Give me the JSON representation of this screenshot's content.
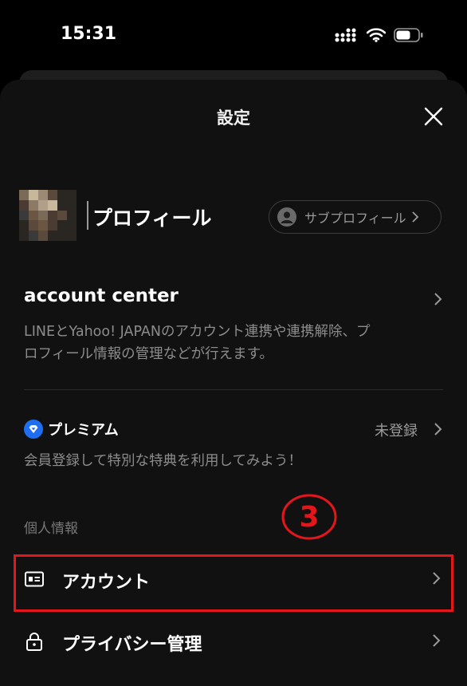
{
  "status_bar": {
    "time": "15:31",
    "icons": [
      "signal-icon",
      "wifi-icon",
      "battery-icon"
    ]
  },
  "header": {
    "title": "設定",
    "close_icon": "close-icon"
  },
  "profile": {
    "label": "プロフィール",
    "sub_profile_label": "サブプロフィール"
  },
  "account_center": {
    "title": "account center",
    "description_line1": "LINEとYahoo! JAPANのアカウント連携や連携解除、プ",
    "description_line2": "ロフィール情報の管理などが行えます。"
  },
  "premium": {
    "logo_text": "プレミアム",
    "status": "未登録",
    "description": "会員登録して特別な特典を利用してみよう！"
  },
  "personal_info": {
    "section_label": "個人情報",
    "items": [
      {
        "label": "アカウント",
        "icon": "id-card-icon"
      },
      {
        "label": "プライバシー管理",
        "icon": "lock-icon"
      }
    ]
  },
  "annotation": {
    "step_number": "3",
    "color": "#e3161c"
  },
  "colors": {
    "sheet_background": "#111111",
    "secondary_text": "#8c8c8c",
    "premium_accent": "#1f6ef0"
  }
}
